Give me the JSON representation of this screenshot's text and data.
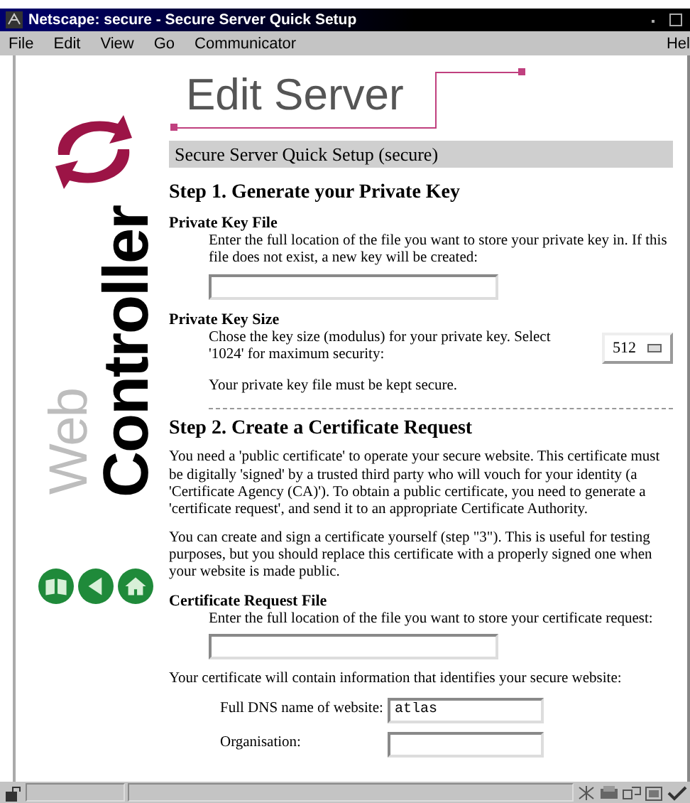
{
  "window": {
    "title": "Netscape: secure - Secure Server Quick Setup",
    "menu": [
      "File",
      "Edit",
      "View",
      "Go",
      "Communicator",
      "Hel"
    ]
  },
  "sidebar": {
    "logo": [
      "Web",
      "Controller"
    ]
  },
  "page": {
    "title": "Edit Server",
    "banner": "Secure Server Quick Setup (secure)",
    "steps": [
      {
        "heading": "Step 1. Generate your Private Key",
        "items": [
          {
            "kind": "field",
            "label": "Private Key File",
            "description": "Enter the full location of the file you want to store your private key in. If this file does not exist, a new key will be created:"
          },
          {
            "kind": "select",
            "label": "Private Key Size",
            "description": "Chose the key size (modulus) for your private key. Select '1024' for maximum security:",
            "value": "512",
            "note": "Your private key file must be kept secure."
          }
        ]
      },
      {
        "heading": "Step 2. Create a Certificate Request",
        "items": [
          {
            "kind": "paragraph",
            "text": "You need a 'public certificate' to operate your secure website. This certificate must be digitally 'signed' by a trusted third party who will vouch for your identity (a 'Certificate Agency (CA)'). To obtain a public certificate, you need to generate a 'certificate request', and send it to an appropriate Certificate Authority."
          },
          {
            "kind": "paragraph",
            "text": "You can create and sign a certificate yourself (step \"3\"). This is useful for testing purposes, but you should replace this certificate with a properly signed one when your website is made public."
          },
          {
            "kind": "field",
            "label": "Certificate Request File",
            "description": "Enter the full location of the file you want to store your certificate request:"
          },
          {
            "kind": "note",
            "text": "Your certificate will contain information that identifies your secure website:"
          },
          {
            "kind": "row",
            "label": "Full DNS name of website:",
            "value": "atlas"
          },
          {
            "kind": "row",
            "label": "Organisation:"
          }
        ]
      }
    ]
  }
}
